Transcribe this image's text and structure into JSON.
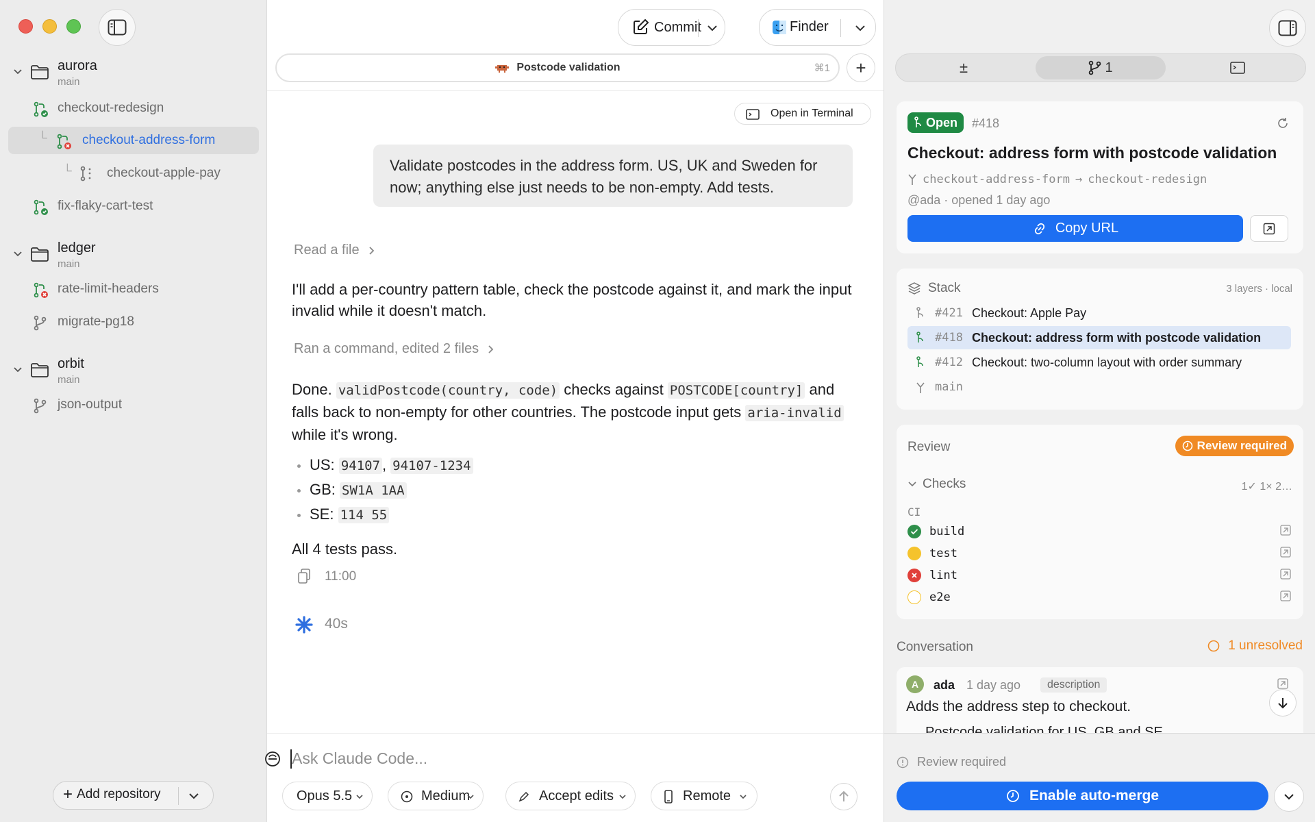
{
  "sidebar": {
    "repos": [
      {
        "name": "aurora",
        "branch": "main",
        "items": [
          "checkout-redesign",
          "checkout-address-form",
          "checkout-apple-pay",
          "fix-flaky-cart-test"
        ]
      },
      {
        "name": "ledger",
        "branch": "main",
        "items": [
          "rate-limit-headers",
          "migrate-pg18"
        ]
      },
      {
        "name": "orbit",
        "branch": "main",
        "items": [
          "json-output"
        ]
      }
    ],
    "add_repository": "Add repository"
  },
  "toolbar": {
    "commit_label": "Commit",
    "finder_label": "Finder"
  },
  "tab": {
    "title": "Postcode validation",
    "shortcut": "⌘1"
  },
  "chat": {
    "open_terminal": "Open in Terminal",
    "user_message": "Validate postcodes in the address form. US, UK and Sweden for now; anything else just needs to be non-empty. Add tests.",
    "read_file": "Read a file",
    "assistant_1": "I'll add a per-country pattern table, check the postcode against it, and mark the input invalid while it doesn't match.",
    "ran_command": "Ran a command, edited 2 files",
    "done_prefix": "Done.",
    "code_fn": "validPostcode(country, code)",
    "checks_against": "checks against",
    "code_table": "POSTCODE[country]",
    "falls_back": "and falls back to non-empty for other countries. The postcode input gets",
    "code_aria": "aria-invalid",
    "while_wrong": "while it's wrong.",
    "bullets": [
      {
        "label": "US:",
        "codes": [
          "94107",
          "94107-1234"
        ]
      },
      {
        "label": "GB:",
        "codes": [
          "SW1A 1AA"
        ]
      },
      {
        "label": "SE:",
        "codes": [
          "114 55"
        ]
      }
    ],
    "tests_pass": "All 4 tests pass.",
    "time": "11:00",
    "duration": "40s",
    "placeholder": "Ask Claude Code..."
  },
  "composer": {
    "model": "Opus 5.5",
    "effort": "Medium",
    "mode": "Accept edits",
    "target": "Remote"
  },
  "pr": {
    "status": "Open",
    "number": "#418",
    "title": "Checkout: address form with postcode validation",
    "head": "checkout-address-form",
    "base": "checkout-redesign",
    "meta": "@ada · opened 1 day ago",
    "copy_url": "Copy URL",
    "tab_count": "1"
  },
  "stack": {
    "title": "Stack",
    "meta": "3 layers · local",
    "rows": [
      {
        "num": "#421",
        "title": "Checkout: Apple Pay"
      },
      {
        "num": "#418",
        "title": "Checkout: address form with postcode validation"
      },
      {
        "num": "#412",
        "title": "Checkout: two-column layout with order summary"
      }
    ],
    "base": "main"
  },
  "review": {
    "title": "Review",
    "badge": "Review required",
    "checks_title": "Checks",
    "checks_summary": "1✓ 1× 2…",
    "group": "CI",
    "checks": [
      {
        "name": "build",
        "status": "pass"
      },
      {
        "name": "test",
        "status": "pending"
      },
      {
        "name": "lint",
        "status": "fail"
      },
      {
        "name": "e2e",
        "status": "queued"
      }
    ]
  },
  "conversation": {
    "title": "Conversation",
    "unresolved": "1 unresolved",
    "author_initial": "A",
    "author": "ada",
    "when": "1 day ago",
    "tag": "description",
    "body": "Adds the address step to checkout.",
    "body_cut": "Postcode validation for US, GB and SE."
  },
  "footer": {
    "status": "Review required",
    "automerge": "Enable auto-merge"
  },
  "colors": {
    "accent": "#1d6ff2",
    "open_green": "#1f8a44",
    "review_orange": "#f08a24",
    "fail_red": "#e0403a",
    "pending_yellow": "#f5c32c"
  }
}
